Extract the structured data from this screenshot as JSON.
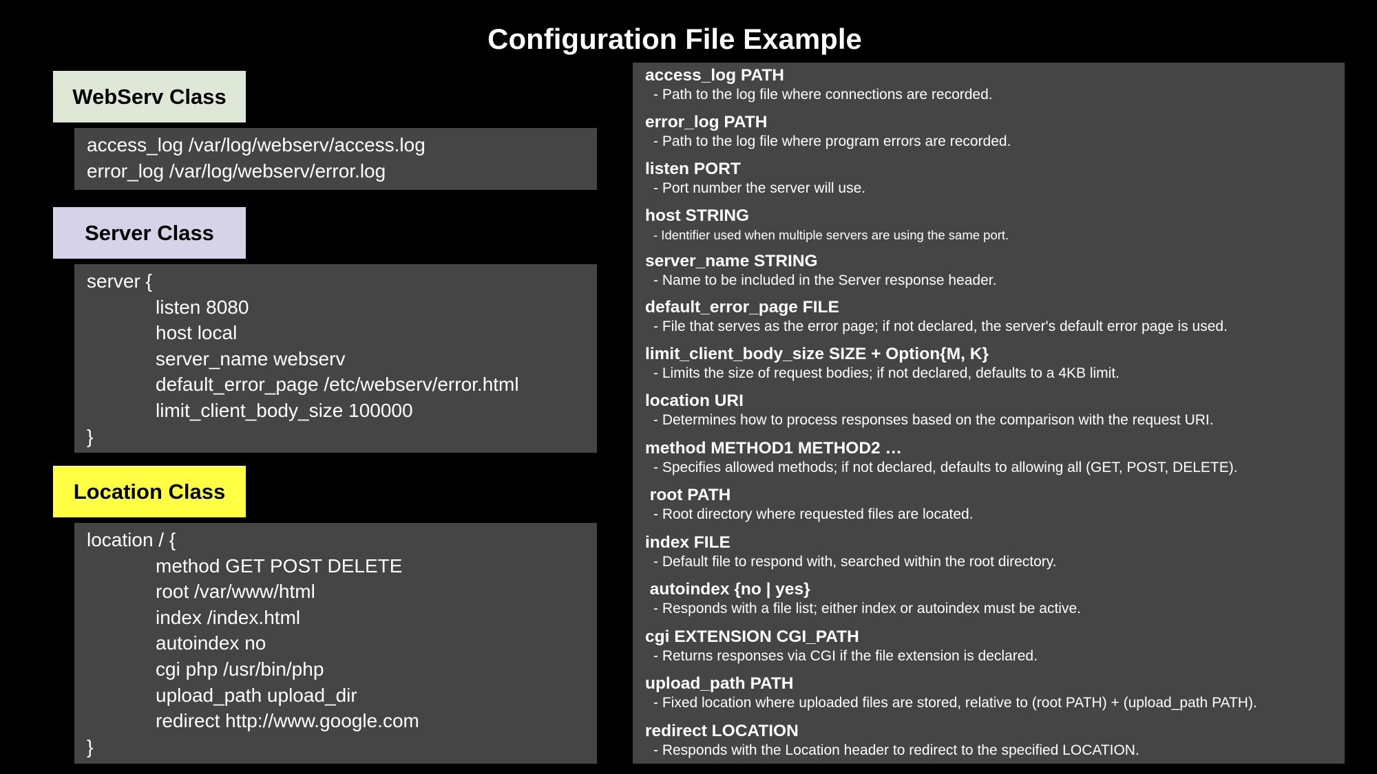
{
  "title": "Configuration File Example",
  "colors": {
    "background": "#000000",
    "panel": "#454545",
    "webserv_label_bg": "#dfe8d6",
    "server_label_bg": "#d6d3e8",
    "location_label_bg": "#ffff44"
  },
  "webserv": {
    "label": "WebServ Class",
    "lines": [
      "access_log /var/log/webserv/access.log",
      "error_log /var/log/webserv/error.log"
    ]
  },
  "server": {
    "label": "Server Class",
    "open": "server {",
    "lines": [
      "listen 8080",
      "host local",
      "server_name webserv",
      "default_error_page /etc/webserv/error.html",
      "limit_client_body_size 100000"
    ],
    "close": "}"
  },
  "location": {
    "label": "Location Class",
    "open": "location / {",
    "lines": [
      "method GET POST DELETE",
      "root /var/www/html",
      "index /index.html",
      "autoindex no",
      "cgi php /usr/bin/php",
      "upload_path upload_dir",
      "redirect http://www.google.com"
    ],
    "close": "}"
  },
  "reference": [
    {
      "name": "access_log PATH",
      "desc": "- Path to the log file where connections are recorded."
    },
    {
      "name": "error_log PATH",
      "desc": "- Path to the log file where program errors are recorded."
    },
    {
      "name": "listen PORT",
      "desc": "- Port number the server will use."
    },
    {
      "name": "host STRING",
      "desc": "- Identifier used when multiple servers are using the same port."
    },
    {
      "name": "server_name STRING",
      "desc": "- Name to be included in the Server response header."
    },
    {
      "name": "default_error_page FILE",
      "desc": "- File that serves as the error page; if not declared, the server's default error page is used."
    },
    {
      "name": "limit_client_body_size SIZE + Option{M, K}",
      "desc": "- Limits the size of request bodies; if not declared, defaults to a 4KB limit."
    },
    {
      "name": "location URI",
      "desc": "- Determines how to process responses based on the comparison with the request URI."
    },
    {
      "name": "method METHOD1 METHOD2 …",
      "desc": "- Specifies allowed methods; if not declared, defaults to allowing all (GET, POST, DELETE)."
    },
    {
      "name": " root PATH",
      "desc": "- Root directory where requested files are located."
    },
    {
      "name": "index FILE",
      "desc": "- Default file to respond with, searched within the root directory."
    },
    {
      "name": " autoindex {no | yes}",
      "desc": "- Responds with a file list; either index or autoindex must be active."
    },
    {
      "name": "cgi EXTENSION CGI_PATH",
      "desc": "- Returns responses via CGI if the file extension is declared."
    },
    {
      "name": "upload_path PATH",
      "desc": "- Fixed location where uploaded files are stored, relative to (root PATH) + (upload_path PATH)."
    },
    {
      "name": "redirect LOCATION",
      "desc": "- Responds with the Location header to redirect to the specified LOCATION."
    }
  ]
}
